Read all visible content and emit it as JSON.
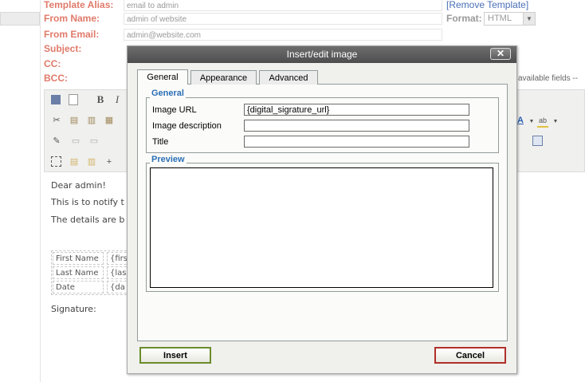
{
  "form": {
    "template_alias_label": "Template Alias:",
    "template_alias_value": "email to admin",
    "from_name_label": "From Name:",
    "from_name_value": "admin of website",
    "from_email_label": "From Email:",
    "from_email_value": "admin@website.com",
    "subject_label": "Subject:",
    "cc_label": "CC:",
    "bcc_label": "BCC:",
    "remove_template_link": "[Remove Template]",
    "format_label": "Format:",
    "format_value": "HTML",
    "available_fields_text": "available fields --"
  },
  "editor": {
    "lines": [
      "Dear admin!",
      "This is to notify t",
      "The details are b"
    ],
    "table": [
      [
        "First Name",
        "{first"
      ],
      [
        "Last Name",
        "{las"
      ],
      [
        "Date",
        "{da"
      ]
    ],
    "signature": "Signature:",
    "toolbar_icons": [
      "save-icon",
      "new-document-icon",
      "bold-icon",
      "italic-icon",
      "cut-icon",
      "copy-icon",
      "paste-icon",
      "paste-text-icon",
      "edit-icon",
      "font-color-icon",
      "highlight-icon",
      "select-all-icon",
      "insert-icon"
    ]
  },
  "dialog": {
    "title": "Insert/edit image",
    "close": "✕",
    "tabs": [
      "General",
      "Appearance",
      "Advanced"
    ],
    "general_legend": "General",
    "image_url_label": "Image URL",
    "image_url_value": "{digital_sigrature_url}",
    "image_description_label": "Image description",
    "image_description_value": "",
    "title_label": "Title",
    "title_value": "",
    "preview_legend": "Preview",
    "insert_button": "Insert",
    "cancel_button": "Cancel"
  },
  "colors": {
    "label": "#e07a6a",
    "link": "#4a6fb6",
    "legend": "#2b6fb6",
    "insert_border": "#6a8d2a",
    "cancel_border": "#b0302a"
  }
}
